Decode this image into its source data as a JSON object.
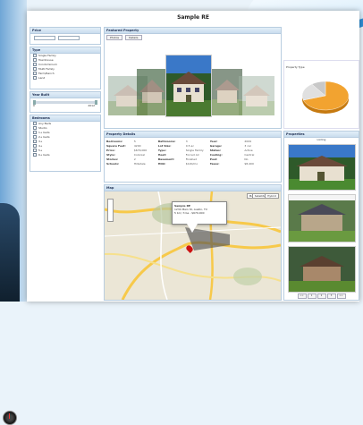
{
  "page": {
    "title": "Sample RE"
  },
  "filters": {
    "price": {
      "header": "Price",
      "from_placeholder": "100,000",
      "to_placeholder": "1,000,000"
    },
    "type": {
      "header": "Type",
      "options": [
        "Single Family",
        "Townhouse",
        "Condominium",
        "Multi Family",
        "Farm/Ranch",
        "Land"
      ]
    },
    "year_built": {
      "header": "Year Built",
      "from": "0",
      "to": "2012"
    },
    "beds": {
      "header": "Bedrooms",
      "any_label": "Any Beds",
      "options": [
        "Studio",
        "1+ beds",
        "2+ beds",
        "3+",
        "4+",
        "5+",
        "6+ beds"
      ]
    }
  },
  "featured": {
    "header": "Featured Property",
    "tabs": [
      "Photos",
      "Details"
    ]
  },
  "stats": {
    "label": "Property Type"
  },
  "details": {
    "header": "Property Details",
    "rows": [
      [
        "Bedrooms:",
        "5",
        "Bathrooms:",
        "3",
        "Year:",
        "2009"
      ],
      [
        "Square Feet:",
        "4200",
        "Lot Size:",
        "0.5 ac",
        "Garage:",
        "3 car"
      ],
      [
        "Price:",
        "$679,000",
        "Type:",
        "Single Family",
        "Status:",
        "Active"
      ],
      [
        "Style:",
        "Colonial",
        "Heat:",
        "Forced Air",
        "Cooling:",
        "Central"
      ],
      [
        "Stories:",
        "2",
        "Basement:",
        "Finished",
        "Pool:",
        "No"
      ],
      [
        "Schools:",
        "Hillsdale",
        "HOA:",
        "$120/mo",
        "Taxes:",
        "$8,400"
      ]
    ]
  },
  "map": {
    "header": "Map",
    "map_btn": "Map",
    "satellite_btn": "Satellite",
    "hybrid_btn": "Hybrid",
    "popup_line1": "Sample RE",
    "popup_line2": "1234 Main St, Austin, TX",
    "popup_line3": "5 bd / 3 ba - $679,000"
  },
  "listings": {
    "header": "Properties",
    "view_label": "Listing",
    "pager": [
      "<<",
      "1",
      "2",
      "3",
      ">>"
    ]
  },
  "chart_data": {
    "type": "pie",
    "values": [
      70,
      20,
      10
    ],
    "categories": [
      "Single Family",
      "Townhouse",
      "Condominium"
    ],
    "colors": [
      "#f2a330",
      "#e0e0e0",
      "#c8c8c8"
    ]
  }
}
